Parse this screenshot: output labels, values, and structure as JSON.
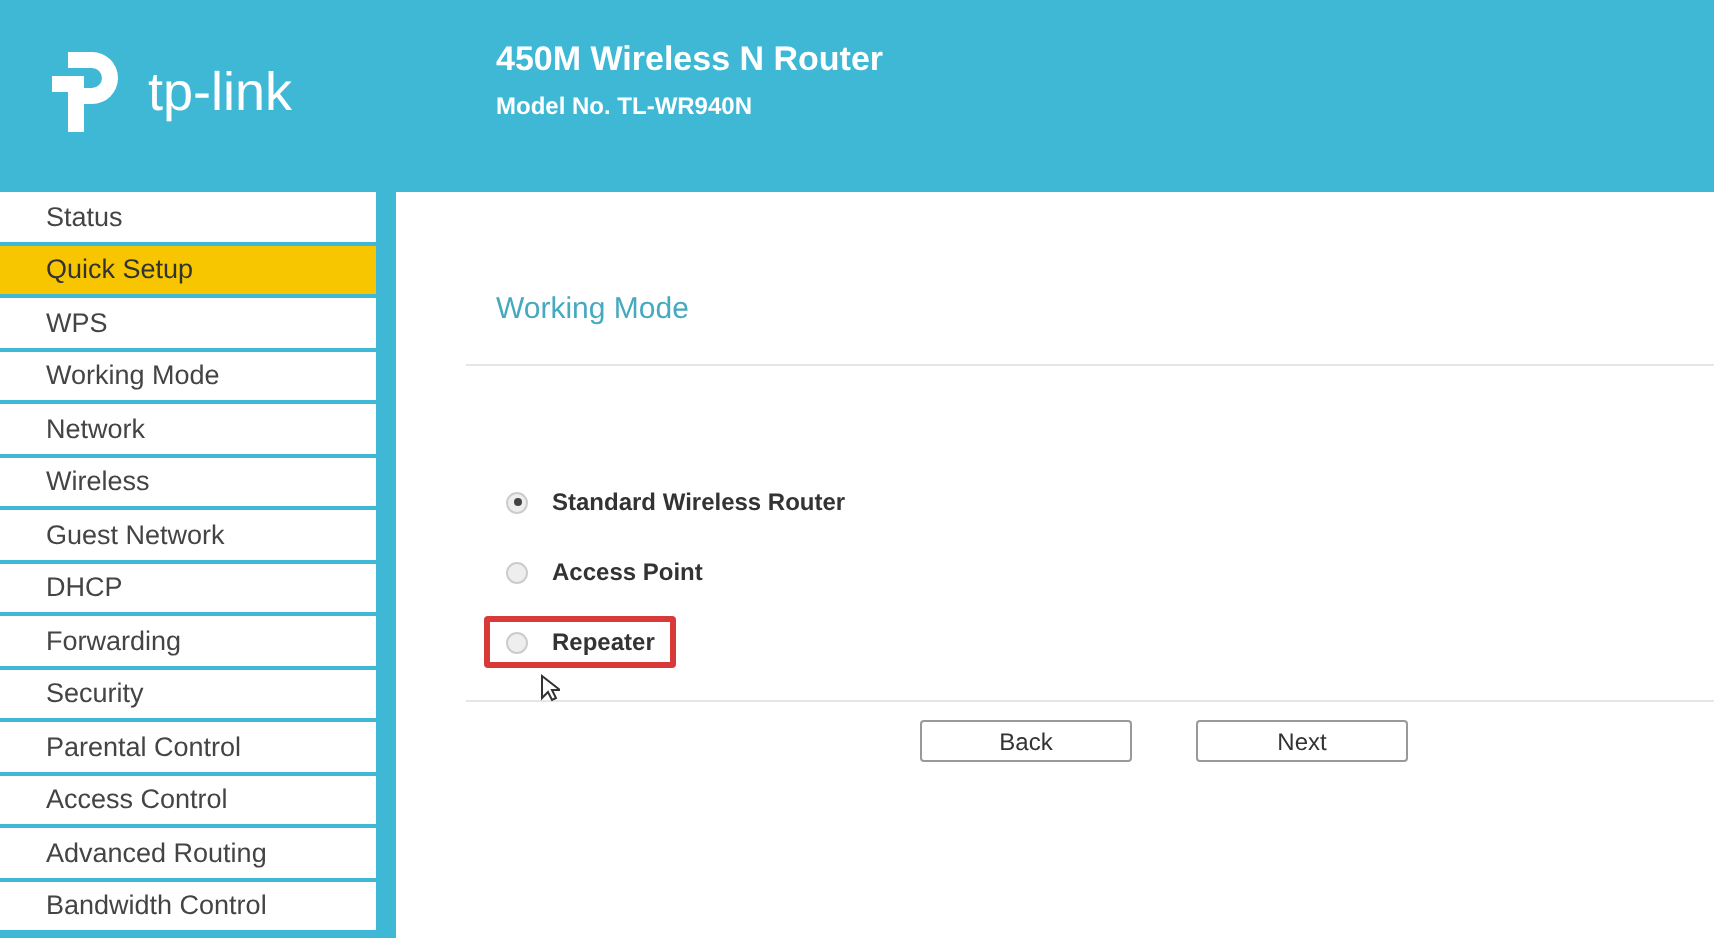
{
  "header": {
    "brand": "tp-link",
    "product": "450M Wireless N Router",
    "model": "Model No. TL-WR940N"
  },
  "sidebar": {
    "items": [
      {
        "label": "Status",
        "selected": false
      },
      {
        "label": "Quick Setup",
        "selected": true
      },
      {
        "label": "WPS",
        "selected": false
      },
      {
        "label": "Working Mode",
        "selected": false
      },
      {
        "label": "Network",
        "selected": false
      },
      {
        "label": "Wireless",
        "selected": false
      },
      {
        "label": "Guest Network",
        "selected": false
      },
      {
        "label": "DHCP",
        "selected": false
      },
      {
        "label": "Forwarding",
        "selected": false
      },
      {
        "label": "Security",
        "selected": false
      },
      {
        "label": "Parental Control",
        "selected": false
      },
      {
        "label": "Access Control",
        "selected": false
      },
      {
        "label": "Advanced Routing",
        "selected": false
      },
      {
        "label": "Bandwidth Control",
        "selected": false
      }
    ]
  },
  "content": {
    "title": "Working Mode",
    "options": [
      {
        "label": "Standard Wireless Router",
        "selected": true,
        "highlighted": false
      },
      {
        "label": "Access Point",
        "selected": false,
        "highlighted": false
      },
      {
        "label": "Repeater",
        "selected": false,
        "highlighted": true
      }
    ],
    "buttons": [
      "Back",
      "Next"
    ]
  }
}
